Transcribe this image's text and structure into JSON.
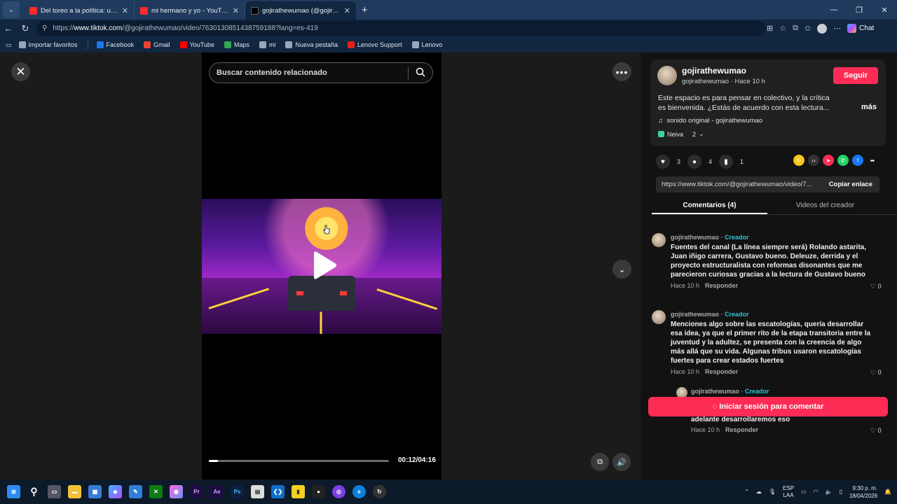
{
  "browser": {
    "tabs": [
      {
        "title": "Del toreo a la política: una charla s",
        "icon": "youtube-icon",
        "active": false
      },
      {
        "title": "mi hermano y yo - YouTube",
        "icon": "youtube-icon",
        "active": false
      },
      {
        "title": "gojirathewumao (@gojirathewumao",
        "icon": "tiktok-icon",
        "active": true
      }
    ],
    "url_prefix": "https://",
    "url_domain": "www.tiktok.com",
    "url_path": "/@gojirathewumao/video/7630130851438759188?lang=es-419",
    "chat_label": "Chat",
    "favorites": [
      {
        "label": "Importar favoritos",
        "color": "#9aa7b8"
      },
      {
        "label": "Facebook",
        "color": "#1877f2"
      },
      {
        "label": "Gmail",
        "color": "#ea4335"
      },
      {
        "label": "YouTube",
        "color": "#ff0000"
      },
      {
        "label": "Maps",
        "color": "#34a853"
      },
      {
        "label": "mi",
        "color": "#9aa7b8"
      },
      {
        "label": "Nueva pestaña",
        "color": "#9aa7b8"
      },
      {
        "label": "Lenovo Support",
        "color": "#e2231a"
      },
      {
        "label": "Lenovo",
        "color": "#9aa7b8"
      }
    ]
  },
  "player": {
    "search_placeholder": "Buscar contenido relacionado",
    "time": "00:12/04:16",
    "progress": 0.05
  },
  "post": {
    "author": "gojirathewumao",
    "author_sub": "gojirathewumao · Hace 10 h",
    "follow": "Seguir",
    "description": "Este espacio es para pensar en colectivo, y la crítica es bienvenida. ¿Estás de acuerdo con esta lectura...",
    "more": "más",
    "sound": "sonido original - gojirathewumao",
    "location": "Neiva",
    "location_count": "2",
    "likes": "3",
    "comments": "4",
    "saves": "1",
    "link": "https://www.tiktok.com/@gojirathewumao/video/7...",
    "copy_link": "Copiar enlace",
    "tab_comments": "Comentarios (4)",
    "tab_videos": "Videos del creador"
  },
  "comments": [
    {
      "user": "gojirathewumao",
      "badge": "· Creador",
      "text": "Fuentes del canal (La línea siempre será) Rolando astarita, Juan iñigo carrera, Gustavo bueno. Deleuze, derrida y el proyecto estructuralista con reformas disonantes que me parecieron curiosas gracias a la lectura de Gustavo bueno",
      "time": "Hace 10 h",
      "reply": "Responder",
      "likes": "0"
    },
    {
      "user": "gojirathewumao",
      "badge": "· Creador",
      "text": "Menciones algo sobre las escatologías, quería desarrollar esa idea, ya que el primer rito de la etapa transitoria entre la juventud y la adultez, se presenta con la creencia de algo más allá que su vida. Algunas tribus usaron escatologías fuertes para crear estados fuertes",
      "time": "Hace 10 h",
      "reply": "Responder",
      "likes": "0"
    },
    {
      "user": "gojirathewumao",
      "badge": "· Creador",
      "text": "Que al final es lo que buscamos, un estado que sea capaz de tener la condición total de su poder. Más adelante desarrollaremos eso",
      "time": "Hace 10 h",
      "reply": "Responder",
      "likes": "0"
    }
  ],
  "login_cta": "Iniciar sesión para comentar",
  "taskbar": {
    "lang_top": "ESP",
    "lang_bottom": "LAA",
    "time": "9:30 p. m.",
    "date": "18/04/2026"
  },
  "colors": {
    "accent": "#fe2c55",
    "creator_badge": "#2fc3d8"
  }
}
